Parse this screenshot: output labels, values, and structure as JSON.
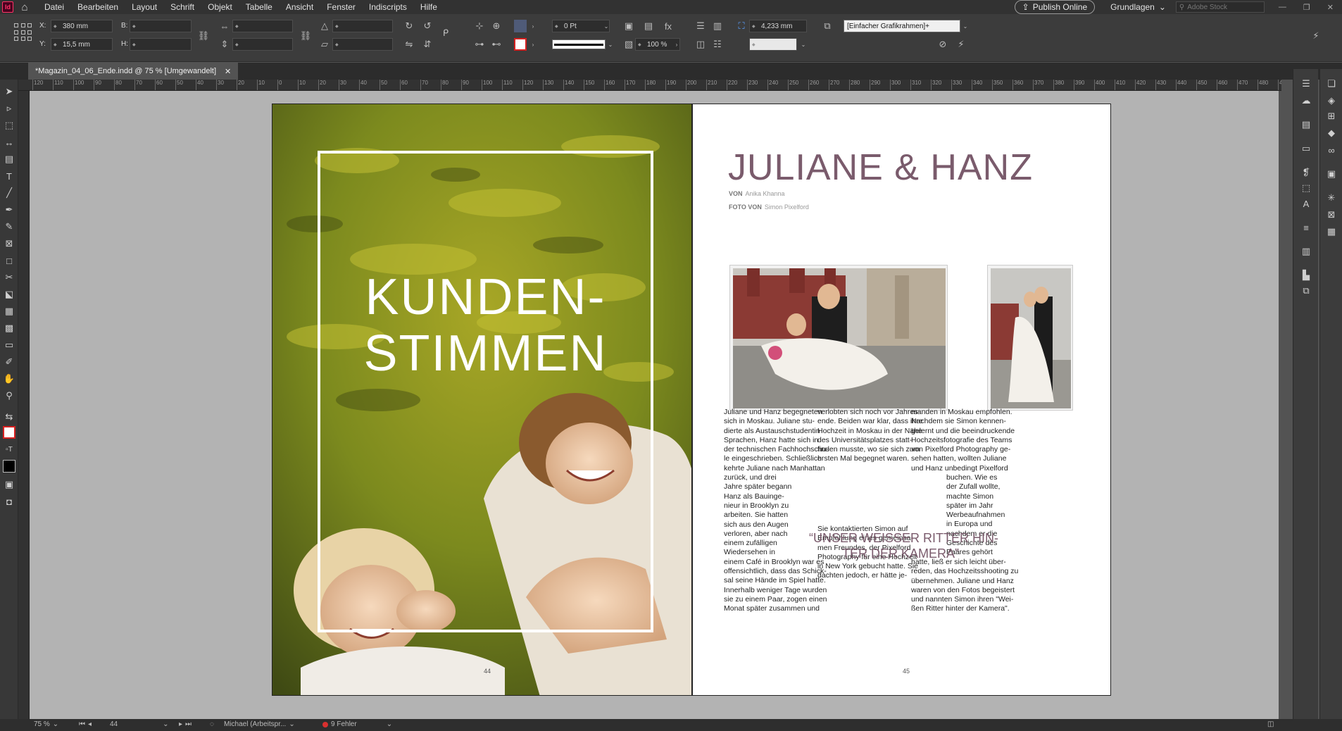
{
  "app": {
    "badge": "Id"
  },
  "menu": [
    "Datei",
    "Bearbeiten",
    "Layout",
    "Schrift",
    "Objekt",
    "Tabelle",
    "Ansicht",
    "Fenster",
    "Indiscripts",
    "Hilfe"
  ],
  "menubar_right": {
    "publish_label": "Publish Online",
    "workspace": "Grundlagen",
    "stock_placeholder": "Adobe Stock"
  },
  "control": {
    "x_label": "X:",
    "x_value": "380 mm",
    "y_label": "Y:",
    "y_value": "15,5 mm",
    "w_label": "B:",
    "h_label": "H:",
    "stroke_weight": "0 Pt",
    "frame_size": "4,233 mm",
    "opacity": "100 %",
    "object_style": "[Einfacher Grafikrahmen]+"
  },
  "document": {
    "tab_title": "*Magazin_04_06_Ende.indd @ 75 % [Umgewandelt]"
  },
  "ruler_ticks": [
    "120",
    "110",
    "100",
    "90",
    "80",
    "70",
    "60",
    "50",
    "40",
    "30",
    "20",
    "10",
    "0",
    "10",
    "20",
    "30",
    "40",
    "50",
    "60",
    "70",
    "80",
    "90",
    "100",
    "110",
    "120",
    "130",
    "140",
    "150",
    "160",
    "170",
    "180",
    "190",
    "200",
    "210",
    "220",
    "230",
    "240",
    "250",
    "260",
    "270",
    "280",
    "290",
    "300",
    "310",
    "320",
    "330",
    "340",
    "350",
    "360",
    "370",
    "380",
    "390",
    "400",
    "410",
    "420",
    "430",
    "440",
    "450",
    "460",
    "470",
    "480",
    "490"
  ],
  "left_page": {
    "title_line1": "KUNDEN-",
    "title_line2": "STIMMEN",
    "page_number": "44"
  },
  "right_page": {
    "title": "JULIANE & HANZ",
    "by_label": "VON",
    "author": "Anika Khanna",
    "photo_label": "FOTO VON",
    "photographer": "Simon Pixelford",
    "col1": [
      "Juliane und Hanz begegneten",
      "sich in Moskau. Juliane stu-",
      "dierte als Austauschstudentin",
      "Sprachen, Hanz hatte sich in",
      "der technischen Fachhochschu-",
      "le eingeschrieben. Schließlich",
      "kehrte Juliane nach Manhattan",
      "zurück, und drei",
      "Jahre später begann",
      "Hanz als Bauinge-",
      "nieur in Brooklyn zu",
      "arbeiten. Sie hatten",
      "sich aus den Augen",
      "verloren, aber nach",
      "einem zufälligen",
      "Wiedersehen in",
      "einem Café in Brooklyn war es",
      "offensichtlich, dass das Schick-",
      "sal seine Hände im Spiel hatte.",
      "Innerhalb weniger Tage wurden",
      "sie zu einem Paar, zogen einen",
      "Monat später zusammen und"
    ],
    "col2_top": [
      "verlobten sich noch vor Jahres-",
      "ende. Beiden war klar, dass ihre",
      "Hochzeit in Moskau in der Nähe",
      "des Universitätsplatzes statt-",
      "finden musste, wo sie sich zum",
      "ersten Mal begegnet waren."
    ],
    "col2_bottom": [
      "Sie kontaktierten Simon auf",
      "Empfehlung eines gemeinsa-",
      "men Freundes, der Pixelford",
      "Photography für eine Hochzeit",
      "in New York gebucht hatte. Sie",
      "dachten jedoch, er hätte je-"
    ],
    "col3_top": [
      "manden in Moskau empfohlen.",
      "Nachdem sie Simon kennen-",
      "gelernt und die beeindruckende",
      "Hochzeitsfotografie des Teams",
      "von Pixelford Photography ge-",
      "sehen hatten, wollten Juliane",
      "und Hanz unbedingt Pixelford"
    ],
    "col3_mid": [
      "buchen. Wie es",
      "der Zufall wollte,",
      "machte Simon",
      "später im Jahr",
      "Werbeaufnahmen",
      "in Europa und",
      "nachdem er die",
      "Geschichte des",
      "Paares gehört"
    ],
    "col3_bottom": [
      "hatte, ließ er sich leicht über-",
      "reden, das Hochzeitsshooting zu",
      "übernehmen. Juliane und Hanz",
      "waren von den Fotos begeistert",
      "und nannten Simon ihren \"Wei-",
      "ßen Ritter hinter der Kamera\"."
    ],
    "pull_quote": "“UNSER WEISSER RITTER HIN-\nTER DER KAMERA”",
    "page_number": "45"
  },
  "status": {
    "zoom": "75 %",
    "page": "44",
    "profile": "Michael (Arbeitspr...",
    "errors": "9 Fehler"
  },
  "colors": {
    "accent": "#7a5b6c",
    "error": "#d9302f"
  }
}
